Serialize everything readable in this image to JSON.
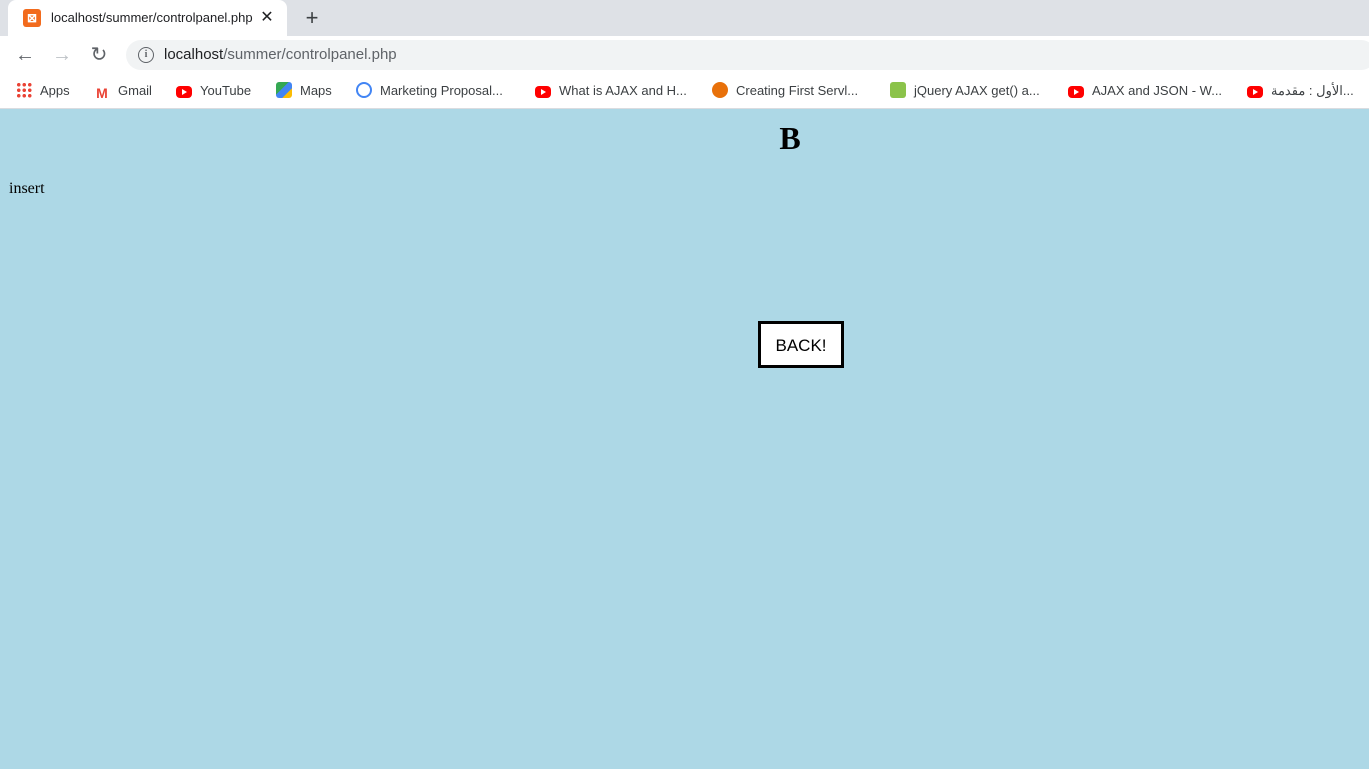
{
  "browser": {
    "tab": {
      "title": "localhost/summer/controlpanel.php",
      "close_label": "✕"
    },
    "new_tab_label": "+",
    "nav": {
      "back": "←",
      "forward": "→",
      "reload": "↻"
    },
    "address": {
      "host": "localhost",
      "path": "/summer/controlpanel.php"
    },
    "bookmarks": [
      {
        "label": "Apps",
        "icon": "apps-grid-icon"
      },
      {
        "label": "Gmail",
        "icon": "gmail-icon"
      },
      {
        "label": "YouTube",
        "icon": "youtube-icon"
      },
      {
        "label": "Maps",
        "icon": "maps-icon"
      },
      {
        "label": "Marketing Proposal...",
        "icon": "marketing-icon"
      },
      {
        "label": "What is AJAX and H...",
        "icon": "youtube-icon"
      },
      {
        "label": "Creating First Servl...",
        "icon": "servlet-icon"
      },
      {
        "label": "jQuery AJAX get() a...",
        "icon": "jquery-icon"
      },
      {
        "label": "AJAX and JSON - W...",
        "icon": "youtube-icon"
      },
      {
        "label": "الأول : مقدمة...",
        "icon": "youtube-icon"
      }
    ]
  },
  "page": {
    "heading": "B",
    "insert_text": "insert",
    "back_button": "BACK!",
    "background": "#add8e6"
  }
}
